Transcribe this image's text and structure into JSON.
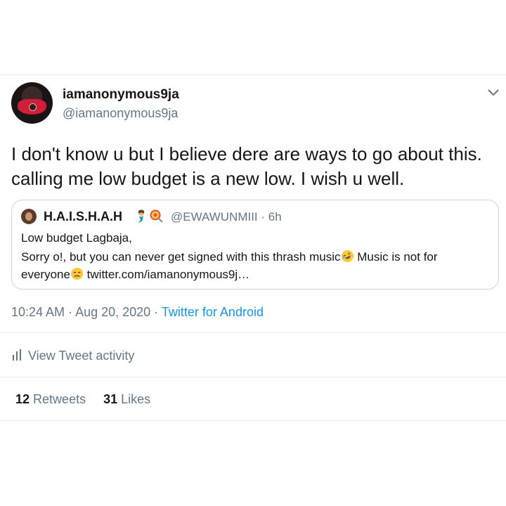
{
  "tweet": {
    "display_name": "iamanonymous9ja",
    "handle": "@iamanonymous9ja",
    "text": "I don't know u but I believe dere are ways to go about this. calling me low budget is a new low. I wish u well.",
    "menu_icon": "chevron-down-icon",
    "avatar_icon": "avatar-red-mask"
  },
  "quoted": {
    "display_name": "H.A.I.S.H.A.H",
    "name_emojis": [
      "mermaid-emoji",
      "lollipop-emoji"
    ],
    "handle": "@EWAWUNMIII",
    "separator": "·",
    "time": "6h",
    "line1": "Low budget Lagbaja,",
    "line2_a": "Sorry o!, but you can never get signed with this thrash music",
    "line2_b": " Music is not for",
    "line3_a": "everyone",
    "line3_b": " twitter.com/iamanonymous9j…",
    "inline_emojis": [
      "rofl-emoji",
      "unamused-emoji"
    ]
  },
  "meta": {
    "time": "10:24 AM",
    "separator": "·",
    "date": "Aug 20, 2020",
    "separator2": "·",
    "source": "Twitter for Android"
  },
  "activity": {
    "label": "View Tweet activity",
    "icon": "bar-chart-icon"
  },
  "stats": {
    "retweets_count": "12",
    "retweets_label": "Retweets",
    "likes_count": "31",
    "likes_label": "Likes"
  },
  "colors": {
    "text": "#14171a",
    "secondary": "#657786",
    "link": "#1b95e0",
    "border": "#e6ecf0"
  }
}
